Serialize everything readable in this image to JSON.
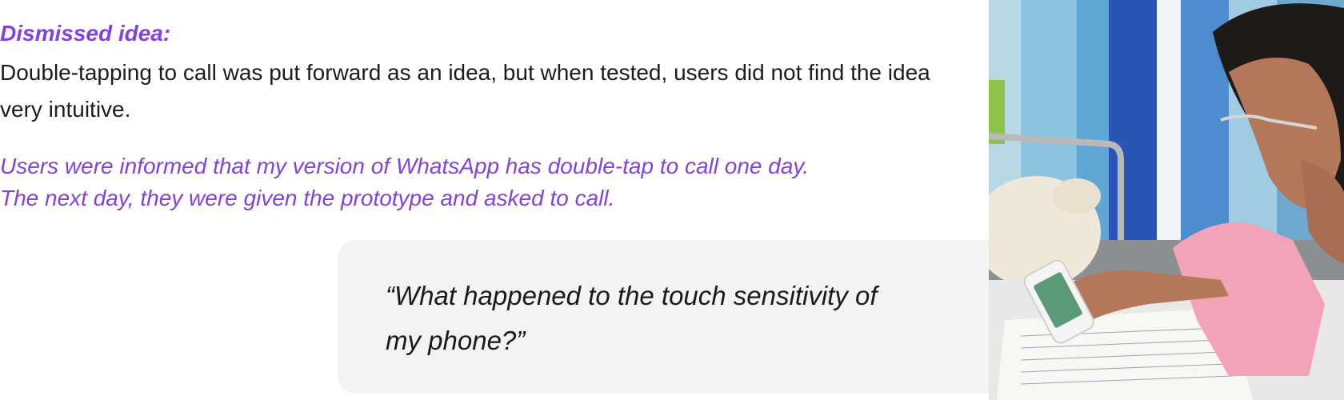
{
  "section": {
    "heading": "Dismissed idea:",
    "description": "Double-tapping to call was put forward as an idea, but when tested, users did not find the idea very intuitive.",
    "test_note_line1": "Users were informed that my version of WhatsApp has double-tap to call one day.",
    "test_note_line2": "The next day, they were given the prototype and asked to call."
  },
  "quote": {
    "line1": "“What happened to the touch sensitivity of",
    "line2": "my phone?”"
  },
  "photo": {
    "subject": "woman-using-phone-in-hospital-bed",
    "colors": {
      "curtain_dark": "#2a55b7",
      "curtain_light": "#8cc4e0",
      "shirt": "#f2a3b8",
      "skin": "#b3785a",
      "hair": "#1e1a18",
      "plush": "#efe7d8"
    }
  },
  "colors": {
    "accent": "#8142dd",
    "text": "#1c1c1c",
    "card_bg": "#f3f3f3"
  }
}
